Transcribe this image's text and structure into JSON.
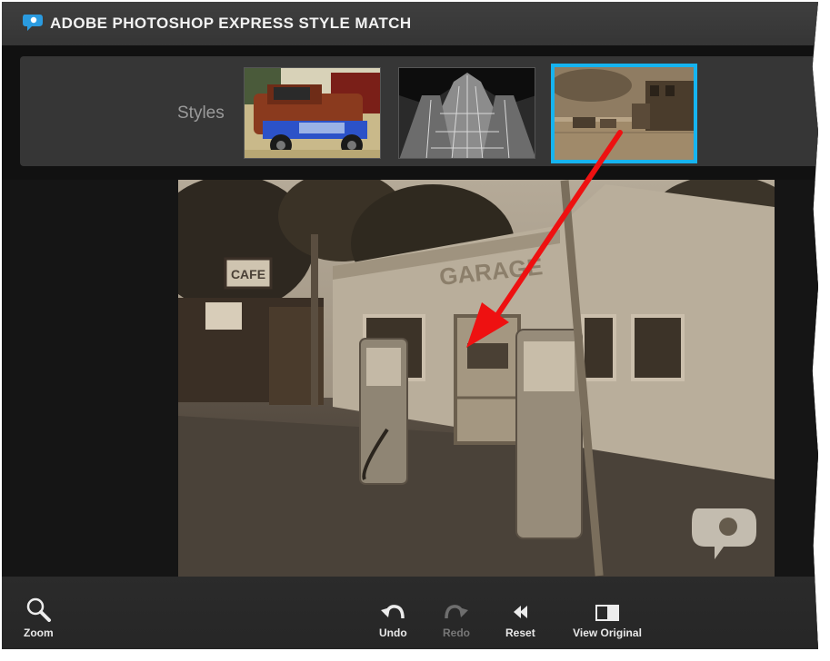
{
  "window": {
    "title": "ADOBE PHOTOSHOP EXPRESS STYLE MATCH"
  },
  "styles_bar": {
    "label": "Styles",
    "thumbnails": [
      {
        "name": "rusty-truck",
        "selected": false
      },
      {
        "name": "cathedral-bw",
        "selected": false
      },
      {
        "name": "western-town-sepia",
        "selected": true
      }
    ]
  },
  "photo": {
    "signs": {
      "cafe": "CAFE",
      "garage": "GARAGE"
    }
  },
  "toolbar": {
    "zoom_label": "Zoom",
    "undo_label": "Undo",
    "redo_label": "Redo",
    "reset_label": "Reset",
    "view_original_label": "View Original"
  },
  "colors": {
    "selection_border": "#16b4f0",
    "annotation_arrow": "#ee1111",
    "title_text": "#f2f2f2",
    "styles_label": "#9a9a9a"
  },
  "icons": [
    "app-logo-icon",
    "zoom-icon",
    "undo-icon",
    "redo-icon",
    "reset-icon",
    "view-original-icon",
    "watermark-logo-icon"
  ]
}
